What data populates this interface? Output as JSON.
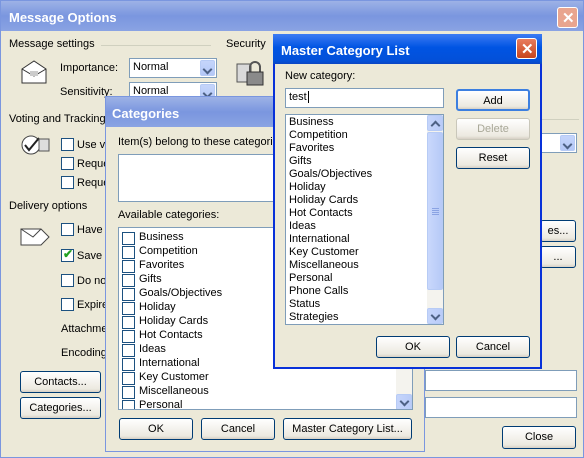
{
  "message_options": {
    "title": "Message Options",
    "message_settings": {
      "heading": "Message settings",
      "importance_label": "Importance:",
      "importance_value": "Normal",
      "sensitivity_label": "Sensitivity:",
      "sensitivity_value": "Normal"
    },
    "security": {
      "heading": "Security"
    },
    "voting": {
      "heading": "Voting and Tracking",
      "use_voting_partial": "Use vo",
      "request_1_partial": "Reque",
      "request_2_partial": "Reque"
    },
    "delivery": {
      "heading": "Delivery options",
      "have_partial": "Have",
      "save_partial": "Save s",
      "do_not_partial": "Do no",
      "expires_partial": "Expire",
      "attachment_partial": "Attachme",
      "encoding_partial": "Encoding",
      "save_checked": true
    },
    "contacts_button": "Contacts...",
    "categories_button": "Categories...",
    "right_button_1_partial": "es...",
    "right_button_2_partial": "...",
    "close_button": "Close"
  },
  "categories_dialog": {
    "title": "Categories",
    "belong_label": "Item(s) belong to these categori",
    "available_label": "Available categories:",
    "items": [
      "Business",
      "Competition",
      "Favorites",
      "Gifts",
      "Goals/Objectives",
      "Holiday",
      "Holiday Cards",
      "Hot Contacts",
      "Ideas",
      "International",
      "Key Customer",
      "Miscellaneous",
      "Personal"
    ],
    "ok_button": "OK",
    "cancel_button": "Cancel",
    "master_button": "Master Category List..."
  },
  "master_dialog": {
    "title": "Master Category List",
    "new_category_label": "New category:",
    "new_category_value": "test",
    "add_button": "Add",
    "delete_button": "Delete",
    "reset_button": "Reset",
    "items": [
      "Business",
      "Competition",
      "Favorites",
      "Gifts",
      "Goals/Objectives",
      "Holiday",
      "Holiday Cards",
      "Hot Contacts",
      "Ideas",
      "International",
      "Key Customer",
      "Miscellaneous",
      "Personal",
      "Phone Calls",
      "Status",
      "Strategies"
    ],
    "ok_button": "OK",
    "cancel_button": "Cancel"
  }
}
